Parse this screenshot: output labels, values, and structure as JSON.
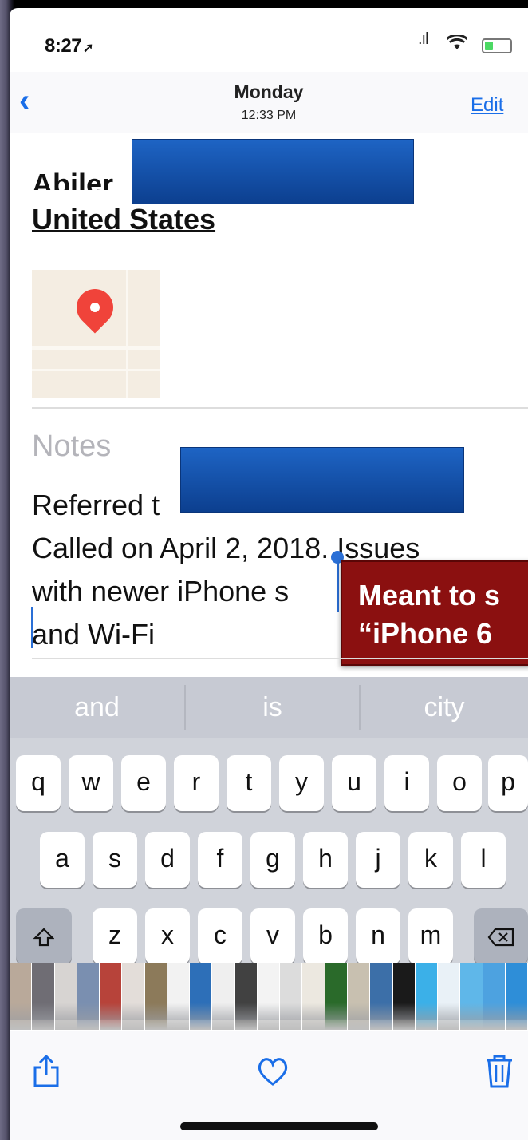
{
  "status_bar": {
    "time": "8:27",
    "location_arrow": "location-arrow-icon",
    "signal": ".ıl",
    "wifi": "wifi-icon",
    "battery": "battery-icon"
  },
  "nav": {
    "back_icon": "chevron-left-icon",
    "day": "Monday",
    "time": "12:33 PM",
    "edit_label": "Edit"
  },
  "contact": {
    "address_line1_visible": "Abiler",
    "address_line2": "United States",
    "map_icon": "map-pin-icon"
  },
  "notes": {
    "label": "Notes",
    "line1": "Referred t",
    "line2": "Called on April 2, 2018. Issues",
    "line3": "with newer iPhone s",
    "line4": "and Wi-Fi"
  },
  "callout": {
    "text": "Meant to s\n“iPhone 6"
  },
  "keyboard": {
    "suggestions": [
      "and",
      "is",
      "city"
    ],
    "row1": [
      "q",
      "w",
      "e",
      "r",
      "t",
      "y",
      "u",
      "i",
      "o",
      "p"
    ],
    "row2": [
      "a",
      "s",
      "d",
      "f",
      "g",
      "h",
      "j",
      "k",
      "l"
    ],
    "row3": [
      "z",
      "x",
      "c",
      "v",
      "b",
      "n",
      "m"
    ],
    "shift_icon": "shift-icon",
    "delete_icon": "delete-icon"
  },
  "photo_strip": {
    "colors": [
      "#b9a99a",
      "#6f6d74",
      "#d7d4d2",
      "#7a8fb0",
      "#b7433a",
      "#e3ddd9",
      "#8c7a5a",
      "#f2f2f2",
      "#2d6fb8",
      "#efefef",
      "#414141",
      "#f3f3f3",
      "#dcdcdc",
      "#ece8e0",
      "#2a6a2a",
      "#c8c0b0",
      "#3c6fa8",
      "#1a1a1a",
      "#3bb0e8",
      "#e9f1f7",
      "#5fb7e9",
      "#4da2e0",
      "#2e8ed8"
    ]
  },
  "toolbar": {
    "share_icon": "share-icon",
    "favorite_icon": "heart-icon",
    "delete_icon": "trash-icon"
  },
  "colors": {
    "accent": "#1a6ee8",
    "callout_bg": "#8b1010",
    "redaction": "#1255b0"
  }
}
